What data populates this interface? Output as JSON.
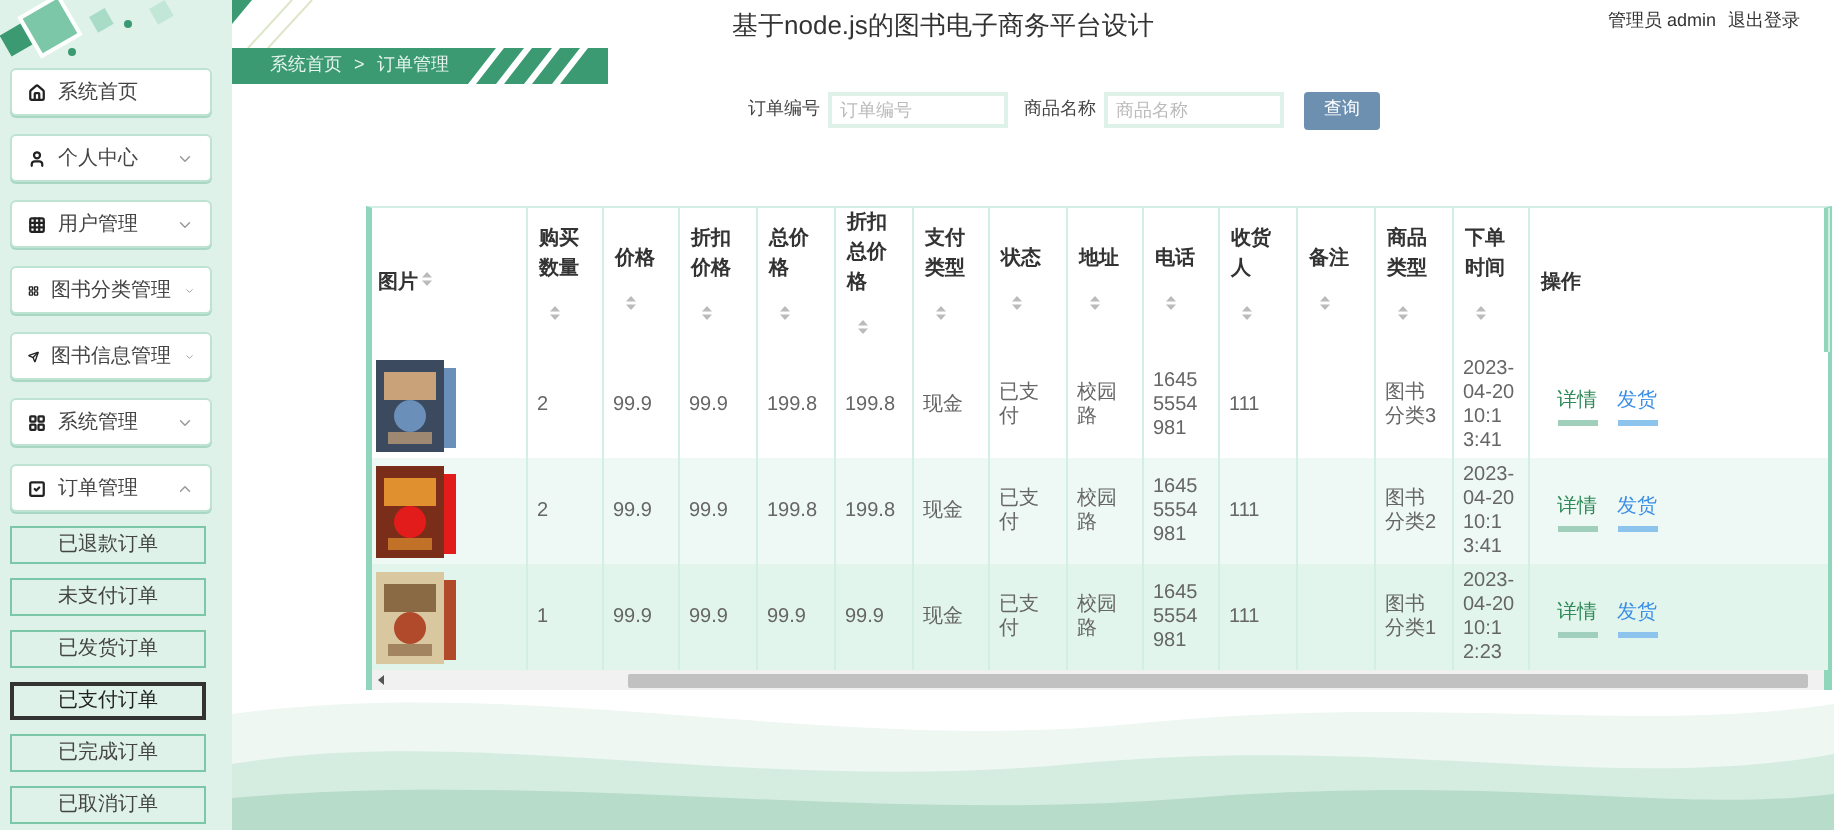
{
  "page": {
    "title": "基于node.js的图书电子商务平台设计",
    "user": "管理员 admin",
    "logout": "退出登录"
  },
  "sidebar": {
    "items": [
      {
        "label": "系统首页",
        "expandable": false
      },
      {
        "label": "个人中心",
        "expandable": true,
        "expanded": false
      },
      {
        "label": "用户管理",
        "expandable": true,
        "expanded": false
      },
      {
        "label": "图书分类管理",
        "expandable": true,
        "expanded": false
      },
      {
        "label": "图书信息管理",
        "expandable": true,
        "expanded": false
      },
      {
        "label": "系统管理",
        "expandable": true,
        "expanded": false
      },
      {
        "label": "订单管理",
        "expandable": true,
        "expanded": true,
        "children": [
          {
            "label": "已退款订单",
            "selected": false
          },
          {
            "label": "未支付订单",
            "selected": false
          },
          {
            "label": "已发货订单",
            "selected": false
          },
          {
            "label": "已支付订单",
            "selected": true
          },
          {
            "label": "已完成订单",
            "selected": false
          },
          {
            "label": "已取消订单",
            "selected": false
          }
        ]
      }
    ]
  },
  "breadcrumb": [
    "系统首页",
    "订单管理"
  ],
  "breadcrumb_separator": ">",
  "search": {
    "fields": [
      {
        "label": "订单编号",
        "placeholder": "订单编号"
      },
      {
        "label": "商品名称",
        "placeholder": "商品名称"
      }
    ],
    "button": "查询"
  },
  "table": {
    "columns": [
      {
        "label": "图片",
        "sortable": true
      },
      {
        "label": "购买数量",
        "sortable": true
      },
      {
        "label": "价格",
        "sortable": true
      },
      {
        "label": "折扣价格",
        "sortable": true
      },
      {
        "label": "总价格",
        "sortable": true
      },
      {
        "label": "折扣总价格",
        "sortable": true
      },
      {
        "label": "支付类型",
        "sortable": true
      },
      {
        "label": "状态",
        "sortable": true
      },
      {
        "label": "地址",
        "sortable": true
      },
      {
        "label": "电话",
        "sortable": true
      },
      {
        "label": "收货人",
        "sortable": true
      },
      {
        "label": "备注",
        "sortable": true
      },
      {
        "label": "商品类型",
        "sortable": true
      },
      {
        "label": "下单时间",
        "sortable": true
      },
      {
        "label": "操作",
        "sortable": false
      }
    ],
    "rows": [
      {
        "cells": [
          "",
          "2",
          "99.9",
          "99.9",
          "199.8",
          "199.8",
          "现金",
          "已支付",
          "校园路",
          "16455554981",
          "111",
          "",
          "图书分类3",
          "2023-04-20 10:13:41"
        ],
        "actions": [
          {
            "label": "详情",
            "kind": "detail"
          },
          {
            "label": "发货",
            "kind": "ship"
          }
        ]
      },
      {
        "cells": [
          "",
          "2",
          "99.9",
          "99.9",
          "199.8",
          "199.8",
          "现金",
          "已支付",
          "校园路",
          "16455554981",
          "111",
          "",
          "图书分类2",
          "2023-04-20 10:13:41"
        ],
        "actions": [
          {
            "label": "详情",
            "kind": "detail"
          },
          {
            "label": "发货",
            "kind": "ship"
          }
        ]
      },
      {
        "cells": [
          "",
          "1",
          "99.9",
          "99.9",
          "99.9",
          "99.9",
          "现金",
          "已支付",
          "校园路",
          "16455554981",
          "111",
          "",
          "图书分类1",
          "2023-04-20 10:12:23"
        ],
        "actions": [
          {
            "label": "详情",
            "kind": "detail"
          },
          {
            "label": "发货",
            "kind": "ship"
          }
        ]
      }
    ]
  }
}
